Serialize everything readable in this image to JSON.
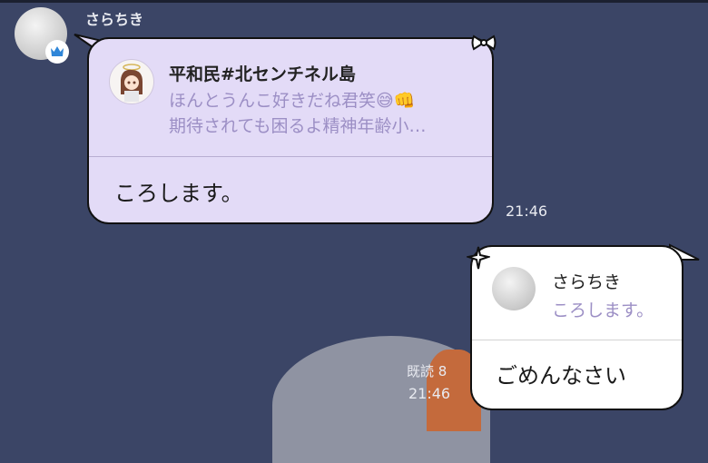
{
  "chat": {
    "sender_name": "さらちき",
    "message1": {
      "reply_name": "平和民#北センチネル島",
      "reply_line1": "ほんとうんこ好きだね君笑😅👊",
      "reply_line2": "期待されても困るよ精神年齢小…",
      "text": "ころします。",
      "time": "21:46"
    },
    "message2": {
      "reply_name": "さらちき",
      "reply_text": "ころします。",
      "text": "ごめんなさい",
      "read_status": "既読 8",
      "time": "21:46"
    }
  },
  "colors": {
    "background": "#3b4566",
    "bubble_received": "#e3dbf7",
    "bubble_sent": "#ffffff",
    "reply_text": "#9c8fc5"
  },
  "icons": [
    "crown-icon",
    "bow-icon",
    "sparkle-icon"
  ]
}
